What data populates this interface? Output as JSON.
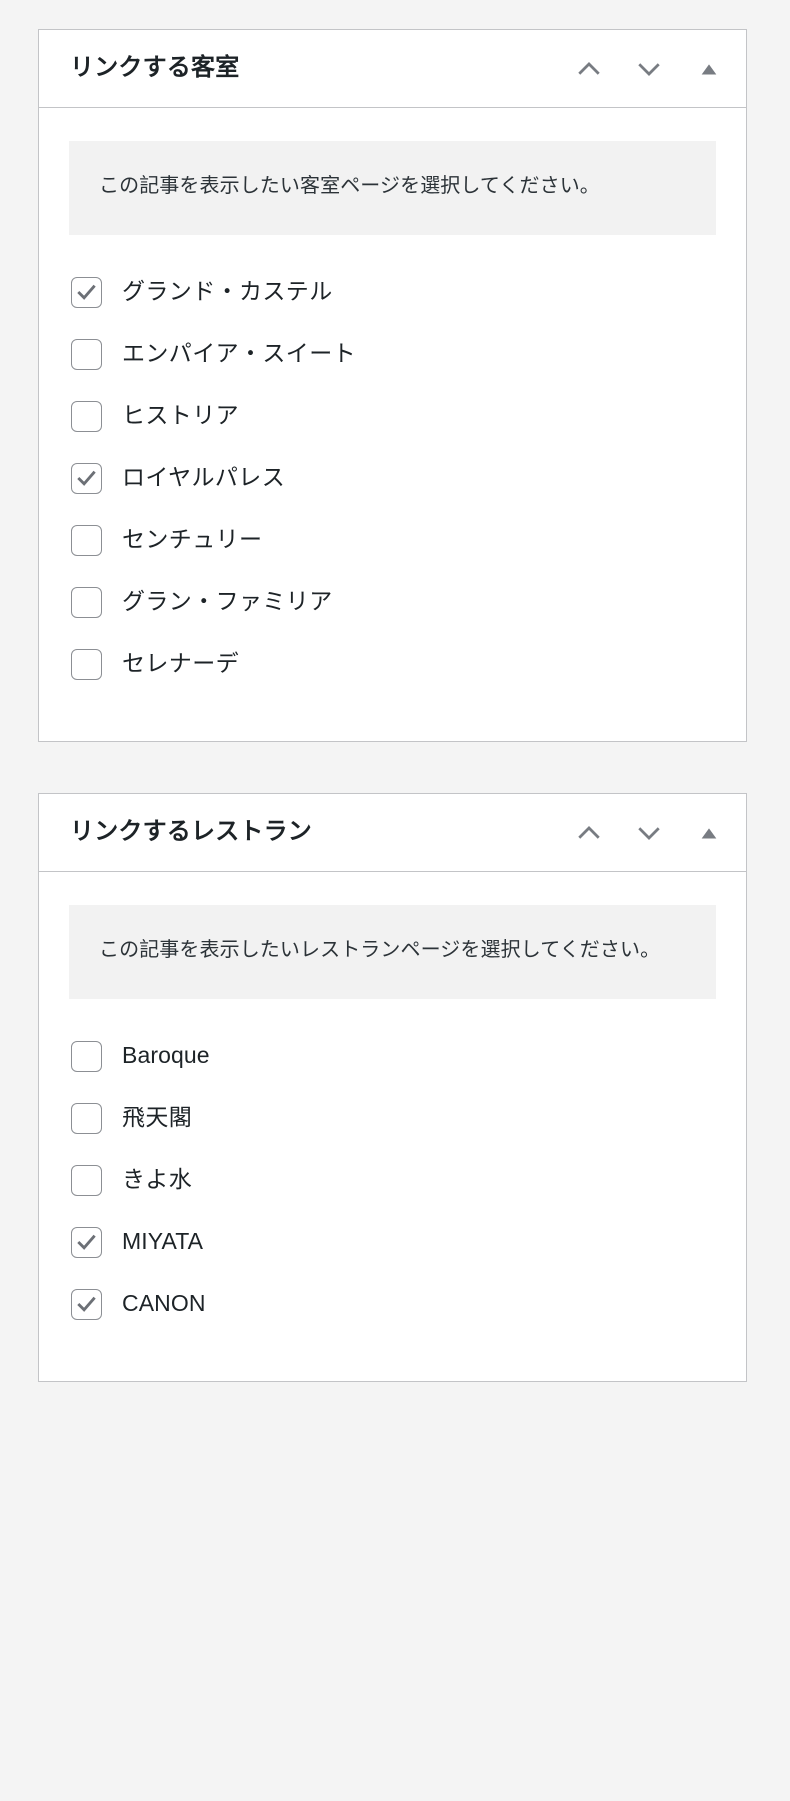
{
  "panels": [
    {
      "title": "リンクする客室",
      "actions": [
        {
          "name": "move-up-button",
          "icon": "chevron-up-icon"
        },
        {
          "name": "move-down-button",
          "icon": "chevron-down-icon"
        },
        {
          "name": "toggle-panel-button",
          "icon": "triangle-up-icon"
        }
      ],
      "notice": "この記事を表示したい客室ページを選択してください。",
      "items": [
        {
          "label": "グランド・カステル",
          "checked": true,
          "latin": false
        },
        {
          "label": "エンパイア・スイート",
          "checked": false,
          "latin": false
        },
        {
          "label": "ヒストリア",
          "checked": false,
          "latin": false
        },
        {
          "label": "ロイヤルパレス",
          "checked": true,
          "latin": false
        },
        {
          "label": "センチュリー",
          "checked": false,
          "latin": false
        },
        {
          "label": "グラン・ファミリア",
          "checked": false,
          "latin": false
        },
        {
          "label": "セレナーデ",
          "checked": false,
          "latin": false
        }
      ]
    },
    {
      "title": "リンクするレストラン",
      "actions": [
        {
          "name": "move-up-button",
          "icon": "chevron-up-icon"
        },
        {
          "name": "move-down-button",
          "icon": "chevron-down-icon"
        },
        {
          "name": "toggle-panel-button",
          "icon": "triangle-up-icon"
        }
      ],
      "notice": "この記事を表示したいレストランページを選択してください。",
      "items": [
        {
          "label": "Baroque",
          "checked": false,
          "latin": true
        },
        {
          "label": "飛天閣",
          "checked": false,
          "latin": false
        },
        {
          "label": "きよ水",
          "checked": false,
          "latin": false
        },
        {
          "label": "MIYATA",
          "checked": true,
          "latin": true
        },
        {
          "label": "CANON",
          "checked": true,
          "latin": true
        }
      ]
    }
  ],
  "colors": {
    "page_background": "#f4f4f4",
    "panel_background": "#ffffff",
    "panel_border": "#c3c4c7",
    "notice_background": "#f2f2f2",
    "text": "#1d2327",
    "icon": "#787c82",
    "checkbox_border": "#8c8f94",
    "checkmark": "#6c7076"
  }
}
